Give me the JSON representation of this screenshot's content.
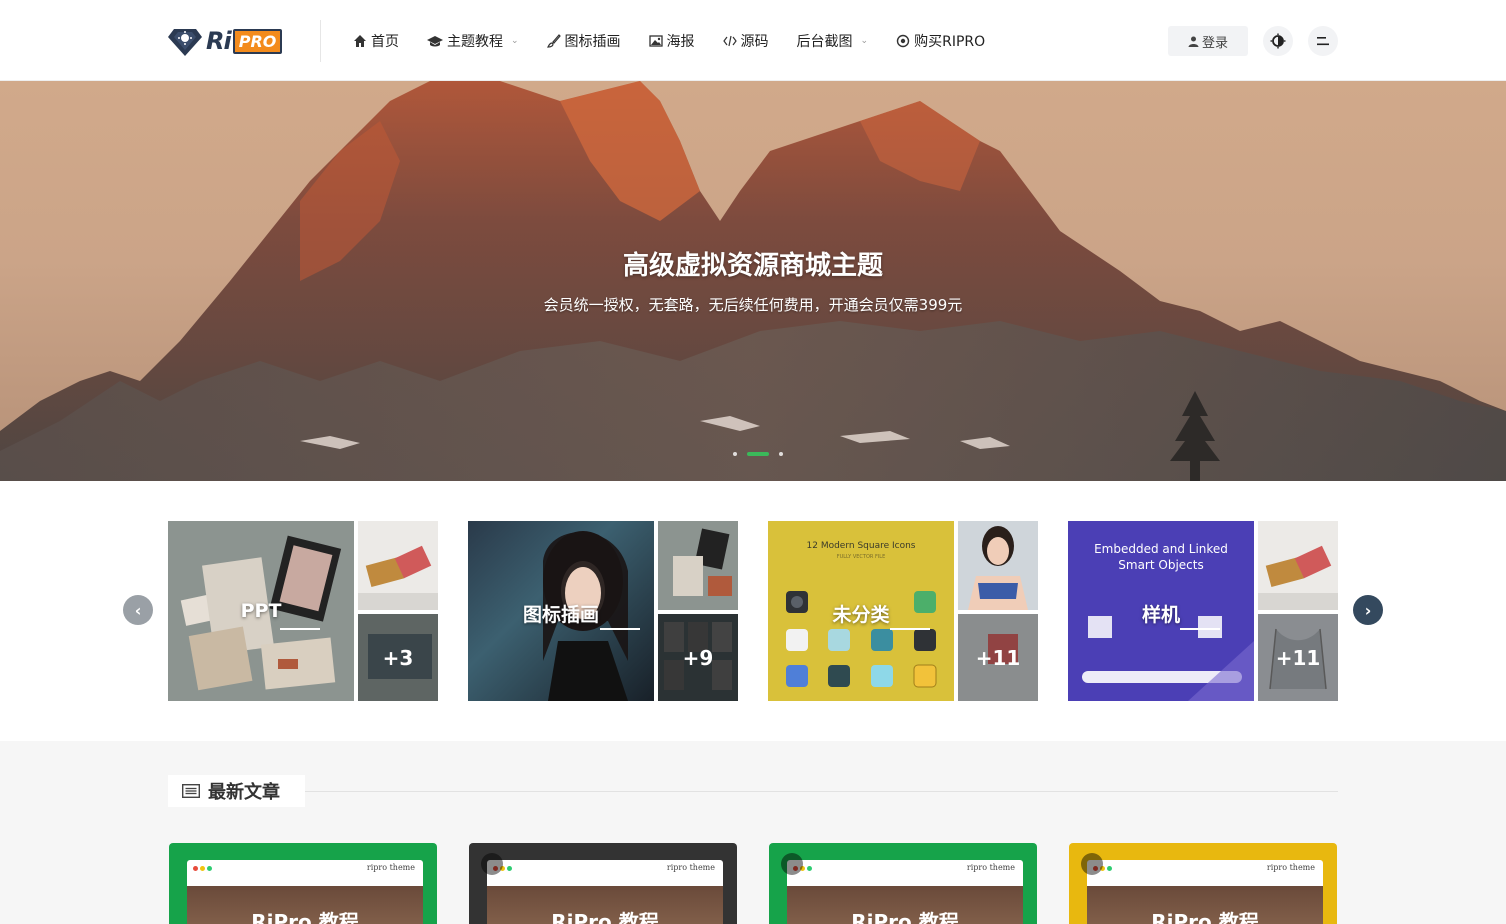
{
  "brand": {
    "logo_text": "Ri",
    "logo_badge": "PRO"
  },
  "nav": {
    "items": [
      {
        "label": "首页",
        "icon": "home-icon"
      },
      {
        "label": "主题教程",
        "icon": "graduation-cap-icon",
        "has_dropdown": true
      },
      {
        "label": "图标插画",
        "icon": "paint-brush-icon"
      },
      {
        "label": "海报",
        "icon": "image-icon"
      },
      {
        "label": "源码",
        "icon": "code-icon"
      },
      {
        "label": "后台截图",
        "icon": "",
        "has_dropdown": true
      },
      {
        "label": "购买RIPRO",
        "icon": "circle-dot-icon"
      }
    ],
    "login_label": "登录",
    "login_icon": "user-icon",
    "theme_toggle_icon": "contrast-icon",
    "menu_icon": "menu-icon"
  },
  "hero": {
    "title": "高级虚拟资源商城主题",
    "subtitle": "会员统一授权，无套路，无后续任何费用，开通会员仅需399元",
    "slides": 3,
    "active_slide": 1
  },
  "categories": {
    "prev_icon": "chevron-left-icon",
    "next_icon": "chevron-right-icon",
    "items": [
      {
        "name": "PPT",
        "extra": "+3"
      },
      {
        "name": "图标插画",
        "extra": "+9"
      },
      {
        "name": "未分类",
        "extra": "+11"
      },
      {
        "name": "样机",
        "extra": "+11"
      }
    ],
    "embedded_texts": {
      "icons_title": "12 Modern Square Icons",
      "icons_subtitle": "FULLY VECTOR FILE",
      "embedded_title_1": "Embedded and Linked",
      "embedded_title_2": "Smart Objects"
    }
  },
  "latest": {
    "section_title": "最新文章",
    "section_icon": "list-icon",
    "posts": [
      {
        "brand": "ripro theme",
        "hero_text": "RiPro 教程",
        "frame_color": "#16a34a",
        "locked": false
      },
      {
        "brand": "ripro theme",
        "hero_text": "RiPro 教程",
        "frame_color": "#333333",
        "locked": true
      },
      {
        "brand": "ripro theme",
        "hero_text": "RiPro 教程",
        "frame_color": "#16a34a",
        "locked": true
      },
      {
        "brand": "ripro theme",
        "hero_text": "RiPro 教程",
        "frame_color": "#e8b80f",
        "locked": true
      }
    ]
  },
  "colors": {
    "accent": "#3bb95a",
    "brand_orange": "#f38b1c",
    "brand_navy": "#2b3a52",
    "arrow_prev": "#9aa0a6",
    "arrow_next": "#34495e"
  }
}
